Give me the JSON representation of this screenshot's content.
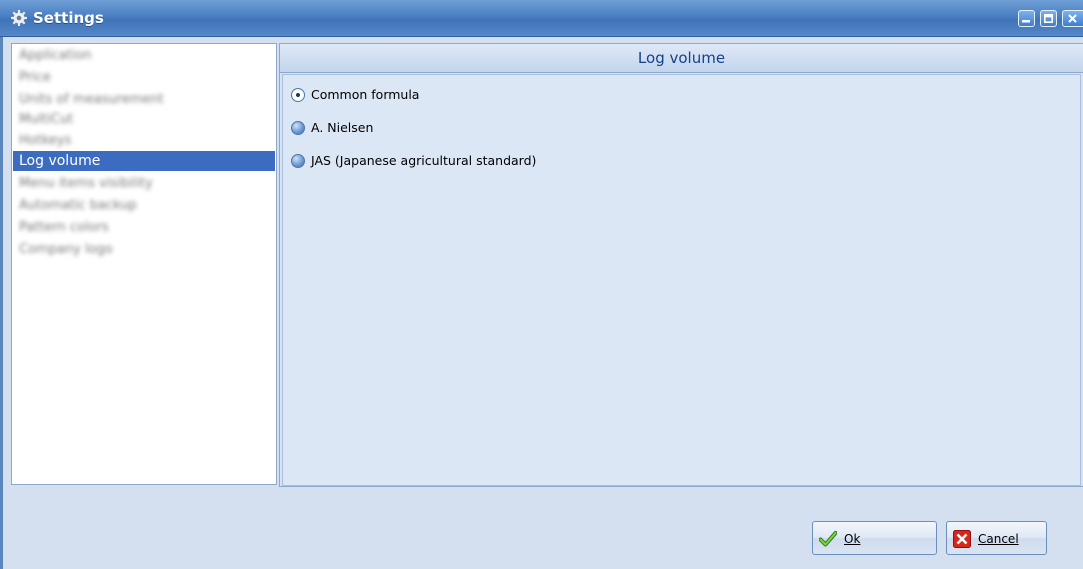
{
  "window": {
    "title": "Settings",
    "icon": "gear-icon"
  },
  "sidebar": {
    "items": [
      {
        "label": "Application",
        "selected": false
      },
      {
        "label": "Price",
        "selected": false
      },
      {
        "label": "Units of measurement",
        "selected": false
      },
      {
        "label": "MultiCut",
        "selected": false
      },
      {
        "label": "Hotkeys",
        "selected": false
      },
      {
        "label": "Log volume",
        "selected": true
      },
      {
        "label": "Menu items visibility",
        "selected": false
      },
      {
        "label": "Automatic backup",
        "selected": false
      },
      {
        "label": "Pattern colors",
        "selected": false
      },
      {
        "label": "Company logo",
        "selected": false
      }
    ]
  },
  "panel": {
    "title": "Log volume",
    "options": [
      {
        "label": "Common formula",
        "checked": true
      },
      {
        "label": "A. Nielsen",
        "checked": false
      },
      {
        "label": "JAS (Japanese agricultural standard)",
        "checked": false
      }
    ]
  },
  "buttons": {
    "ok_label": "Ok",
    "ok_icon": "checkmark-icon",
    "cancel_label": "Cancel",
    "cancel_icon": "red-x-icon"
  },
  "colors": {
    "titlebar": "#4a7fc2",
    "selection": "#3c6cc2",
    "header_text": "#15428b"
  }
}
